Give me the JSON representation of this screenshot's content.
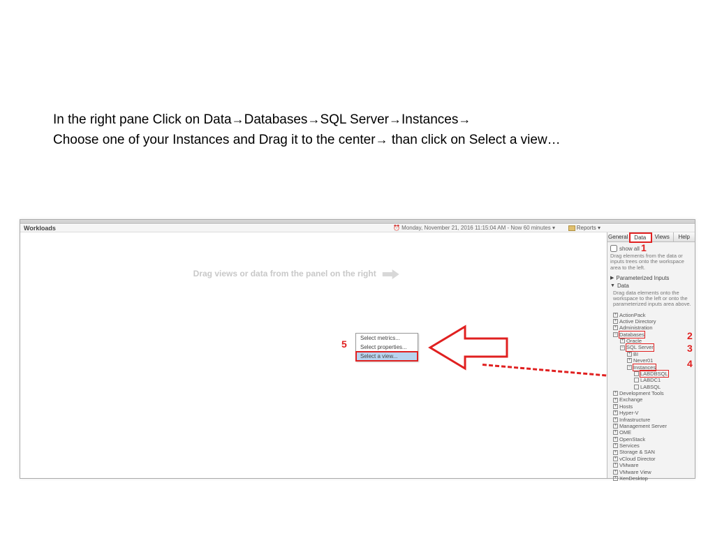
{
  "instructions": {
    "line1_parts": [
      "In the right pane Click on Data",
      "Databases",
      "SQL Server",
      "Instances",
      ""
    ],
    "line2_pre": "Choose one of your Instances and Drag it to the center",
    "line2_post": " than click on Select a view…"
  },
  "app": {
    "title": "Workloads",
    "timestamp": "⏰ Monday, November 21, 2016 11:15:04 AM - Now 60 minutes ▾",
    "reports": "Reports ▾",
    "workspace_hint": "Drag views or data from the panel on the right"
  },
  "context_menu": {
    "items": [
      "Select metrics...",
      "Select properties...",
      "Select a view..."
    ],
    "highlighted_index": 2
  },
  "tabs": [
    "General",
    "Data",
    "Views",
    "Help"
  ],
  "active_tab": 1,
  "panel": {
    "show_all": "show all",
    "help1": "Drag elements from the data or inputs trees onto the workspace area to the left.",
    "acc_param": "Parameterized Inputs",
    "acc_data": "Data",
    "help2": "Drag data elements onto the workspace to the left or onto the parameterized inputs area above.",
    "tree_top": [
      "ActionPack",
      "Active Directory",
      "Administration"
    ],
    "databases": "Databases",
    "db_children": [
      "Oracle"
    ],
    "sqlserver": "SQL Server",
    "sql_children": [
      "BI",
      "Never01"
    ],
    "instances": "Instances",
    "inst_children": [
      "LABDBSQL",
      "LABDC1",
      "LABSQL"
    ],
    "tree_bottom": [
      "Development Tools",
      "Exchange",
      "Hosts",
      "Hyper-V",
      "Infrastructure",
      "Management Server",
      "OME",
      "OpenStack",
      "Services",
      "Storage & SAN",
      "vCloud Director",
      "VMware",
      "VMware View",
      "XenDesktop"
    ]
  },
  "annotations": {
    "1": "1",
    "2": "2",
    "3": "3",
    "4": "4",
    "5": "5"
  }
}
